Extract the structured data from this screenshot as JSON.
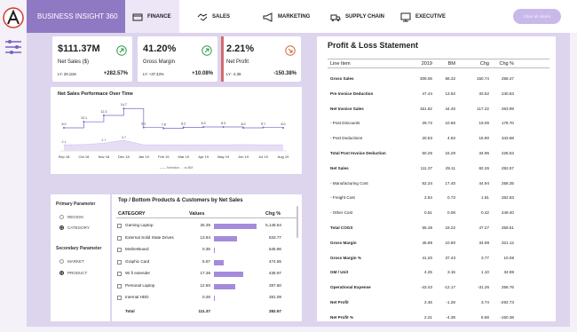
{
  "brand": "BUSINESS INSIGHT 360",
  "tabs": [
    {
      "label": "FINANCE",
      "icon": "finance-icon",
      "active": true
    },
    {
      "label": "SALES",
      "icon": "handshake-icon",
      "active": false
    },
    {
      "label": "MARKETING",
      "icon": "megaphone-icon",
      "active": false
    },
    {
      "label": "SUPPLY CHAIN",
      "icon": "supply-chain-icon",
      "active": false
    },
    {
      "label": "EXECUTIVE",
      "icon": "executive-icon",
      "active": false
    }
  ],
  "top_button": "Clear all slicers",
  "kpis": [
    {
      "value": "$111.37M",
      "label": "Net Sales ($)",
      "ly": "LY: 29.11M",
      "pct": "+282.57%",
      "trend": "up",
      "color": "#2e9b4a"
    },
    {
      "value": "41.20%",
      "label": "Gross Margin",
      "ly": "LY: +37.43%",
      "pct": "+10.08%",
      "trend": "up",
      "color": "#2e9b4a"
    },
    {
      "value": "2.21%",
      "label": "Net Profit",
      "ly": "LY: -4.38",
      "pct": "-150.38%",
      "trend": "down",
      "color": "#d06a3a"
    }
  ],
  "line_chart": {
    "title": "Net Sales Performace Over Time",
    "legend": "—— Selection - - vs BM"
  },
  "chart_data": {
    "type": "line",
    "title": "Net Sales Performace Over Time",
    "categories": [
      "Sep 18",
      "Oct 18",
      "Nov 18",
      "Dec 18",
      "Jan 19",
      "Feb 19",
      "Mar 19",
      "Apr 19",
      "May 19",
      "Jun 19",
      "Jul 19",
      "Aug 19"
    ],
    "series": [
      {
        "name": "Selection",
        "values": [
          8.0,
          10.1,
          12.3,
          14.7,
          8.1,
          7.8,
          8.2,
          8.3,
          8.3,
          8.0,
          8.1,
          8.0
        ]
      },
      {
        "name": "vs BM",
        "values": [
          2.1,
          2.2,
          2.7,
          3.7,
          2.1,
          2.1,
          2.1,
          2.1,
          2.1,
          2.2,
          2.1,
          2.1
        ]
      }
    ],
    "labels_top": [
      "8.0",
      "10.1",
      "12.3",
      "14.7",
      "8.1",
      "7.8",
      "8.2",
      "8.3",
      "8.3",
      "8.0",
      "8.1",
      "8.0"
    ],
    "labels_bottom": [
      "2.1",
      "",
      "2.7",
      "3.7",
      "",
      "",
      "",
      "",
      "",
      "",
      "",
      ""
    ],
    "ylim": [
      0,
      16
    ]
  },
  "params": {
    "primary_title": "Primary Parameter",
    "primary_options": [
      {
        "label": "REGION",
        "selected": false
      },
      {
        "label": "CATEGORY",
        "selected": true
      }
    ],
    "secondary_title": "Secondary Parameter",
    "secondary_options": [
      {
        "label": "MARKET",
        "selected": false
      },
      {
        "label": "PRODUCT",
        "selected": true
      }
    ]
  },
  "products": {
    "title": "Top / Bottom Products & Customers by Net Sales",
    "headers": [
      "CATEGORY",
      "Values",
      "Chg %"
    ],
    "rows": [
      {
        "name": "Gaming Laptop",
        "value": "25.35",
        "bar": 25.35,
        "chg": "5,148.54"
      },
      {
        "name": "External Solid State Drives",
        "value": "13.84",
        "bar": 13.84,
        "chg": "633.77"
      },
      {
        "name": "MotherBoard",
        "value": "0.36",
        "bar": 0.36,
        "chg": "545.96"
      },
      {
        "name": "Graphic Card",
        "value": "5.67",
        "bar": 5.67,
        "chg": "474.55"
      },
      {
        "name": "Wi fi extender",
        "value": "17.36",
        "bar": 17.36,
        "chg": "436.97"
      },
      {
        "name": "Personal Laptop",
        "value": "12.60",
        "bar": 12.6,
        "chg": "287.60"
      },
      {
        "name": "Internal HDD",
        "value": "0.28",
        "bar": 0.28,
        "chg": "281.09"
      }
    ],
    "total": {
      "name": "Total",
      "value": "111.37",
      "chg": "282.57"
    }
  },
  "pl": {
    "title": "Profit & Loss Statement",
    "headers": [
      "Line Item",
      "2019",
      "BM",
      "Chg",
      "Chg %"
    ],
    "rows": [
      {
        "item": "Gross Sales",
        "v2019": "309.06",
        "bm": "58.32",
        "chg": "150.74",
        "chgp": "258.47",
        "bold": true
      },
      {
        "item": "Pre Invoice Deduction",
        "v2019": "47.44",
        "bm": "13.92",
        "chg": "33.52",
        "chgp": "240.83",
        "bold": true
      },
      {
        "item": "Net Invoice Sales",
        "v2019": "161.62",
        "bm": "44.40",
        "chg": "117.22",
        "chgp": "263.99",
        "bold": true
      },
      {
        "item": "- Post Discounts",
        "v2019": "29.72",
        "bm": "10.66",
        "chg": "19.06",
        "chgp": "178.70",
        "bold": false
      },
      {
        "item": "- Post Deductions",
        "v2019": "20.53",
        "bm": "4.63",
        "chg": "15.90",
        "chgp": "343.68",
        "bold": false
      },
      {
        "item": "Total Post Invoice Deduction",
        "v2019": "50.25",
        "bm": "15.29",
        "chg": "34.96",
        "chgp": "228.63",
        "bold": true
      },
      {
        "item": "Net Sales",
        "v2019": "111.37",
        "bm": "29.11",
        "chg": "82.26",
        "chgp": "282.57",
        "bold": true
      },
      {
        "item": "- Manufacturing Cost",
        "v2019": "62.34",
        "bm": "17.40",
        "chg": "44.94",
        "chgp": "258.35",
        "bold": false
      },
      {
        "item": "- Freight Cost",
        "v2019": "2.64",
        "bm": "0.73",
        "chg": "1.91",
        "chgp": "262.83",
        "bold": false
      },
      {
        "item": "- Other Cost",
        "v2019": "0.51",
        "bm": "0.09",
        "chg": "0.42",
        "chgp": "449.40",
        "bold": false
      },
      {
        "item": "Total COGS",
        "v2019": "65.49",
        "bm": "18.22",
        "chg": "47.27",
        "chgp": "259.51",
        "bold": true
      },
      {
        "item": "Gross Margin",
        "v2019": "45.89",
        "bm": "10.90",
        "chg": "34.99",
        "chgp": "321.12",
        "bold": true
      },
      {
        "item": "Gross Margin %",
        "v2019": "41.20",
        "bm": "37.43",
        "chg": "3.77",
        "chgp": "10.08",
        "bold": true
      },
      {
        "item": "GM / Unit",
        "v2019": "4.25",
        "bm": "3.15",
        "chg": "1.10",
        "chgp": "34.98",
        "bold": true
      },
      {
        "item": "Operational Expense",
        "v2019": "-43.43",
        "bm": "-12.17",
        "chg": "-31.26",
        "chgp": "256.76",
        "bold": true
      },
      {
        "item": "Net Profit",
        "v2019": "2.46",
        "bm": "-1.28",
        "chg": "3.74",
        "chgp": "-292.73",
        "bold": true
      },
      {
        "item": "Net Profit %",
        "v2019": "2.21",
        "bm": "-4.38",
        "chg": "6.59",
        "chgp": "-150.38",
        "bold": true
      }
    ]
  }
}
